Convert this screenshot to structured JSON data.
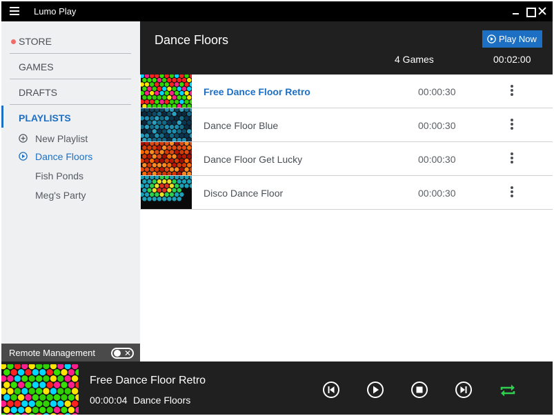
{
  "app": {
    "title": "Lumo Play"
  },
  "sidebar": {
    "nav": [
      {
        "label": "STORE"
      },
      {
        "label": "GAMES"
      },
      {
        "label": "DRAFTS"
      },
      {
        "label": "PLAYLISTS"
      }
    ],
    "playlists": [
      {
        "label": "New Playlist",
        "icon": "plus-circle-icon"
      },
      {
        "label": "Dance Floors",
        "icon": "play-circle-icon"
      },
      {
        "label": "Fish Ponds"
      },
      {
        "label": "Meg's Party"
      }
    ],
    "remote_management": {
      "label": "Remote Management",
      "enabled": false
    }
  },
  "playlist_header": {
    "title": "Dance Floors",
    "play_now_label": "Play Now",
    "count_label": "4 Games",
    "total_duration": "00:02:00"
  },
  "games": [
    {
      "name": "Free Dance Floor Retro",
      "duration": "00:00:30",
      "active": true
    },
    {
      "name": "Dance Floor Blue",
      "duration": "00:00:30",
      "active": false
    },
    {
      "name": "Dance Floor Get Lucky",
      "duration": "00:00:30",
      "active": false
    },
    {
      "name": "Disco Dance Floor",
      "duration": "00:00:30",
      "active": false
    }
  ],
  "now_playing": {
    "title": "Free Dance Floor Retro",
    "elapsed": "00:00:04",
    "playlist": "Dance Floors"
  },
  "colors": {
    "accent": "#1c6fc2",
    "header_bg": "#202020",
    "sidebar_bg": "#eef0f2",
    "store_dot": "#f26b6b",
    "repeat_active": "#2fcf4f"
  }
}
